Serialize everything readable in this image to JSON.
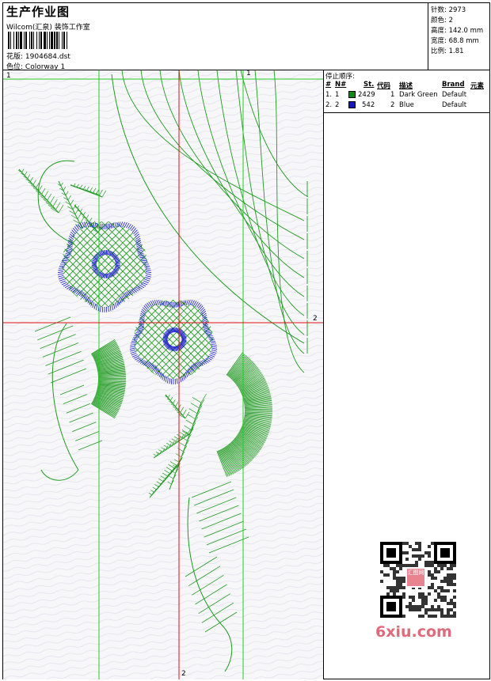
{
  "header": {
    "title": "生产作业图",
    "studio": "Wilcom(汇泉) 装饰工作室",
    "design_label": "花版:",
    "design_value": "1904684.dst",
    "colorway_label": "色位:",
    "colorway_value": "Colorway 1"
  },
  "stats": {
    "stitches_label": "针数:",
    "stitches_value": "2973",
    "colors_label": "颜色:",
    "colors_value": "2",
    "height_label": "高度:",
    "height_value": "142.0 mm",
    "width_label": "宽度:",
    "width_value": "68.8 mm",
    "scale_label": "比例:",
    "scale_value": "1.81"
  },
  "guides": {
    "green_top_left": "1",
    "green_top_right": "1",
    "red_right": "2",
    "red_bottom": "2"
  },
  "stop_sequence": {
    "title": "停止顺序:",
    "columns": [
      "#",
      "N#",
      "St.",
      "代码",
      "描述",
      "Brand",
      "元素"
    ],
    "rows": [
      {
        "index": "1.",
        "needle": "1",
        "stitches": "2429",
        "code": "1",
        "description": "Dark Green",
        "brand": "Default",
        "color": "#118a11"
      },
      {
        "index": "2.",
        "needle": "2",
        "stitches": "542",
        "code": "2",
        "description": "Blue",
        "brand": "Default",
        "color": "#1414c8"
      }
    ]
  },
  "colors": {
    "thread_green": "#1f9a1f",
    "thread_blue": "#1a1ad0",
    "guide_green": "#22cc22",
    "guide_red": "#e01010",
    "canvas_bg": "#f7f7fa"
  },
  "watermark": {
    "text": "6xiu.com",
    "badge": "汇图网"
  }
}
